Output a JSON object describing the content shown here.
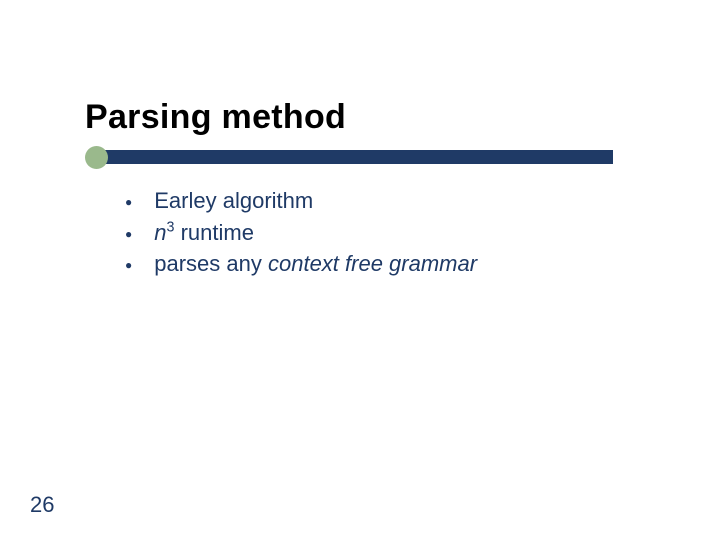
{
  "title": "Parsing method",
  "accent": {
    "circle_color": "#9ab98c",
    "bar_color": "#1f3a66"
  },
  "bullets": [
    {
      "text_html": "Earley algorithm"
    },
    {
      "text_html": "<span class=\"italic\">n</span><sup>3</sup> runtime"
    },
    {
      "text_html": "parses any <span class=\"italic\">context free grammar</span>"
    }
  ],
  "page_number": "26"
}
